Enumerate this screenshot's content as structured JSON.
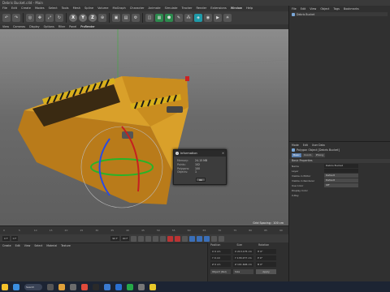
{
  "window": {
    "title": "Debris Bucket.c4d - Main"
  },
  "menubar": {
    "items": [
      "File",
      "Edit",
      "Create",
      "Modes",
      "Select",
      "Tools",
      "Mesh",
      "Spline",
      "Volume",
      "MoGraph",
      "Character",
      "Animate",
      "Simulate",
      "Tracker",
      "Render",
      "Extensions",
      "Window",
      "Help"
    ]
  },
  "viewport_menu": {
    "items": [
      "View",
      "Cameras",
      "Display",
      "Options",
      "Filter",
      "Panel",
      "ProRender"
    ]
  },
  "toolbar": {
    "x": "X",
    "y": "Y",
    "z": "Z"
  },
  "viewport": {
    "grid_spacing": "Grid Spacing : 100 cm"
  },
  "dialog": {
    "title": "Information",
    "rows": [
      {
        "k": "Memory:",
        "v": "24.15 MB"
      },
      {
        "k": "Points:",
        "v": "102"
      },
      {
        "k": "Polygons:",
        "v": "100"
      },
      {
        "k": "Objects:",
        "v": "1"
      }
    ],
    "ok": "Ok"
  },
  "timeline": {
    "ticks": [
      "0",
      "5",
      "10",
      "15",
      "20",
      "25",
      "30",
      "35",
      "40",
      "45",
      "50",
      "55",
      "60",
      "65",
      "70",
      "75",
      "80",
      "85",
      "90"
    ]
  },
  "transport": {
    "start": "0 F",
    "current": "0 F",
    "end": "90 F",
    "end2": "90 F"
  },
  "material_manager": {
    "menu": [
      "Create",
      "Edit",
      "View",
      "Select",
      "Material",
      "Texture"
    ]
  },
  "coordinates": {
    "headers": [
      "Position",
      "Size",
      "Rotation"
    ],
    "rows": [
      {
        "axis": "X",
        "pos": "0 cm",
        "size": "213.175 cm",
        "rot": "H 0°"
      },
      {
        "axis": "Y",
        "pos": "0 cm",
        "size": "133.277 cm",
        "rot": "P 0°"
      },
      {
        "axis": "Z",
        "pos": "0 cm",
        "size": "101.606 cm",
        "rot": "B 0°"
      }
    ],
    "object_mode": "Object (Rel)",
    "size_mode": "Size",
    "apply": "Apply"
  },
  "object_manager": {
    "menu": [
      "File",
      "Edit",
      "View",
      "Object",
      "Tags",
      "Bookmarks"
    ],
    "objects": [
      "Debris Bucket"
    ]
  },
  "attribute_manager": {
    "menu": [
      "Mode",
      "Edit",
      "User Data"
    ],
    "title": "Polygon Object [Debris Bucket]",
    "tabs": [
      "Basic",
      "Coord.",
      "Phong"
    ],
    "section": "Basic Properties",
    "rows": [
      {
        "label": "Name",
        "value": "Debris Bucket",
        "dd": false
      },
      {
        "label": "Layer",
        "value": "",
        "dd": false
      },
      {
        "label": "Visible in Editor",
        "value": "Default",
        "dd": true
      },
      {
        "label": "Visible in Renderer",
        "value": "Default",
        "dd": true
      },
      {
        "label": "Use Color",
        "value": "Off",
        "dd": true
      },
      {
        "label": "Display Color",
        "value": "",
        "dd": false
      },
      {
        "label": "X-Ray",
        "value": "",
        "dd": false
      }
    ]
  },
  "taskbar": {
    "search": "Search"
  },
  "colors": {
    "accent": "#5a7fae",
    "bucket": "#d89a1f",
    "stripe": "#1a1a1a"
  }
}
